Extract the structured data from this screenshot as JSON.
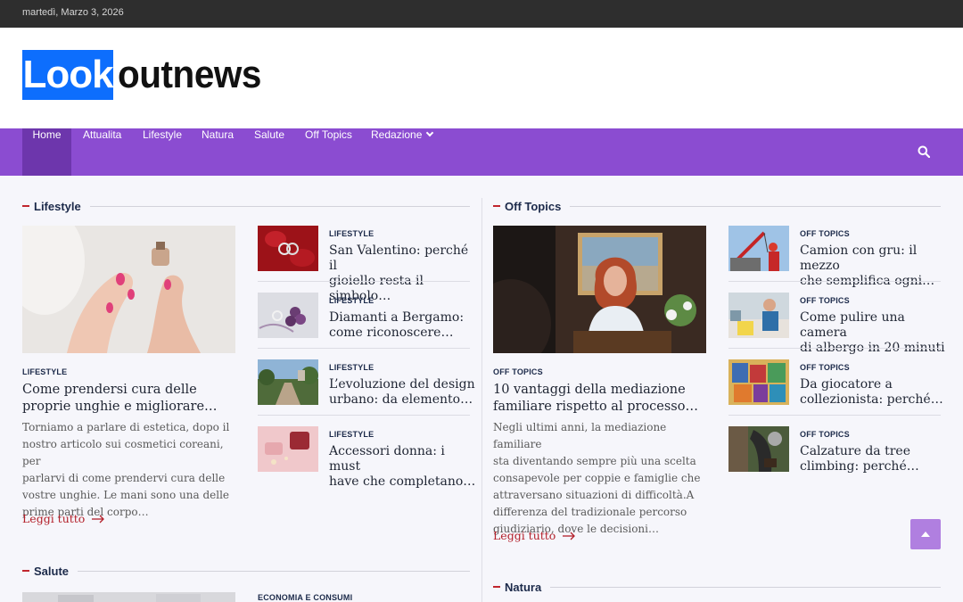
{
  "topbar": {
    "date": "martedì, Marzo 3, 2026"
  },
  "logo": {
    "boxed": "Look",
    "rest": "outnews"
  },
  "nav": {
    "items": [
      "Home",
      "Attualita",
      "Lifestyle",
      "Natura",
      "Salute",
      "Off Topics",
      "Redazione"
    ],
    "active": "Home"
  },
  "sections": {
    "lifestyle": {
      "title": "Lifestyle",
      "featured": {
        "category": "LIFESTYLE",
        "title_l1": "Come prendersi cura delle",
        "title_l2": "proprie unghie e migliorare…",
        "excerpt": [
          "Torniamo a parlare di estetica, dopo il",
          "nostro articolo sui cosmetici coreani, per",
          "parlarvi di come prendervi cura delle",
          "vostre unghie. Le mani sono una delle",
          "prime parti del corpo…"
        ],
        "more": "Leggi tutto"
      },
      "list": [
        {
          "category": "LIFESTYLE",
          "l1": "San Valentino: perché il",
          "l2": "gioiello resta il simbolo…"
        },
        {
          "category": "LIFESTYLE",
          "l1": "Diamanti a Bergamo:",
          "l2": "come riconoscere…"
        },
        {
          "category": "LIFESTYLE",
          "l1": "L’evoluzione del design",
          "l2": "urbano: da elemento…"
        },
        {
          "category": "LIFESTYLE",
          "l1": "Accessori donna: i must",
          "l2": "have che completano…"
        }
      ]
    },
    "offtopics": {
      "title": "Off Topics",
      "featured": {
        "category": "OFF TOPICS",
        "title_l1": "10 vantaggi della mediazione",
        "title_l2": "familiare rispetto al processo…",
        "excerpt": [
          "Negli ultimi anni, la mediazione familiare",
          "sta diventando sempre più una scelta",
          "consapevole per coppie e famiglie che",
          "attraversano situazioni di difficoltà.A",
          "differenza del tradizionale percorso",
          "giudiziario, dove le decisioni…"
        ],
        "more": "Leggi tutto"
      },
      "list": [
        {
          "category": "OFF TOPICS",
          "l1": "Camion con gru: il mezzo",
          "l2": "che semplifica ogni…"
        },
        {
          "category": "OFF TOPICS",
          "l1": "Come pulire una camera",
          "l2": "di albergo in 20 minuti"
        },
        {
          "category": "OFF TOPICS",
          "l1": "Da giocatore a",
          "l2": "collezionista: perché…"
        },
        {
          "category": "OFF TOPICS",
          "l1": "Calzature da tree",
          "l2": "climbing: perché…"
        }
      ]
    },
    "salute": {
      "title": "Salute",
      "first_category": "ECONOMIA E CONSUMI"
    },
    "natura": {
      "title": "Natura"
    }
  },
  "colors": {
    "nav": "#8b4cd1",
    "nav_active": "#6d36ac",
    "logo_box": "#0d6efd",
    "accent_red": "#c0262e",
    "back_to_top": "#b07fe0"
  },
  "icons": {
    "search": "search-icon",
    "back_to_top": "chevron-up-icon",
    "read_more": "arrow-right-icon",
    "dropdown": "chevron-down-icon"
  }
}
